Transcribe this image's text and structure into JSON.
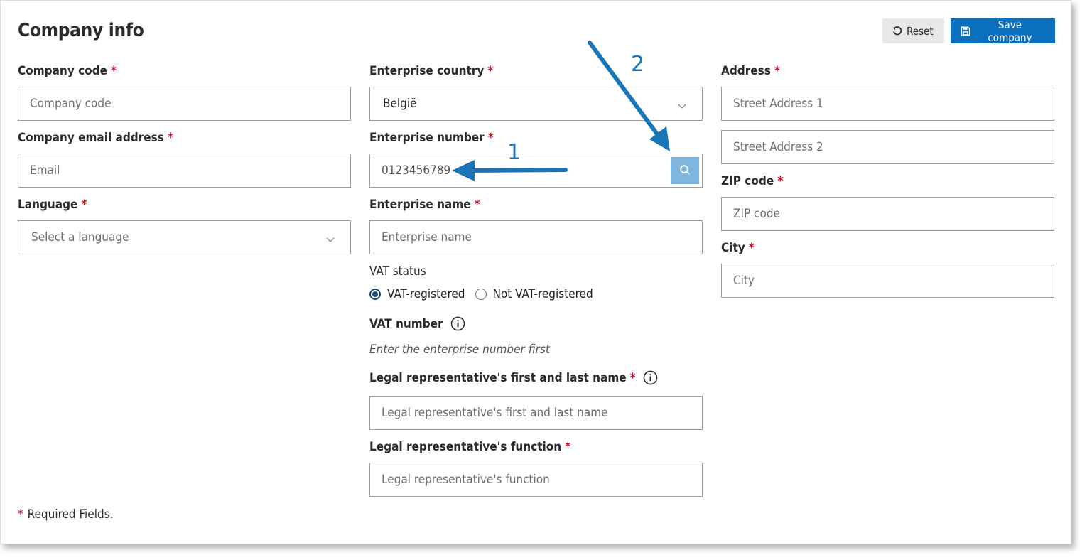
{
  "page": {
    "title": "Company info"
  },
  "toolbar": {
    "reset_label": "Reset",
    "save_label": "Save company"
  },
  "form": {
    "company_code": {
      "label": "Company code",
      "placeholder": "Company code"
    },
    "email": {
      "label": "Company email address",
      "placeholder": "Email"
    },
    "language": {
      "label": "Language",
      "placeholder": "Select a language"
    },
    "enterprise_country": {
      "label": "Enterprise country",
      "value": "België"
    },
    "enterprise_number": {
      "label": "Enterprise number",
      "value": "0123456789"
    },
    "enterprise_name": {
      "label": "Enterprise name",
      "placeholder": "Enterprise name"
    },
    "vat_status": {
      "label": "VAT status",
      "options": [
        "VAT-registered",
        "Not VAT-registered"
      ],
      "selected": "VAT-registered"
    },
    "vat_number": {
      "label": "VAT number",
      "hint": "Enter the enterprise number first"
    },
    "legal_rep_name": {
      "label": "Legal representative's first and last name",
      "placeholder": "Legal representative's first and last name"
    },
    "legal_rep_function": {
      "label": "Legal representative's function",
      "placeholder": "Legal representative's function"
    },
    "address": {
      "label": "Address",
      "placeholder1": "Street Address 1",
      "placeholder2": "Street Address 2"
    },
    "zip": {
      "label": "ZIP code",
      "placeholder": "ZIP code"
    },
    "city": {
      "label": "City",
      "placeholder": "City"
    },
    "required_marker": "*"
  },
  "footer": {
    "required_note": "Required Fields."
  },
  "annotations": {
    "callout_1": "1",
    "callout_2": "2",
    "arrow_color": "#1a74b8"
  },
  "colors": {
    "primary": "#0a70bd",
    "required": "#d0021b",
    "search_button": "#7fb7e0"
  },
  "icons": {
    "reset": "reset-icon",
    "save": "save-icon",
    "search": "search-icon",
    "info": "info-icon",
    "chevron": "chevron-down-icon"
  }
}
